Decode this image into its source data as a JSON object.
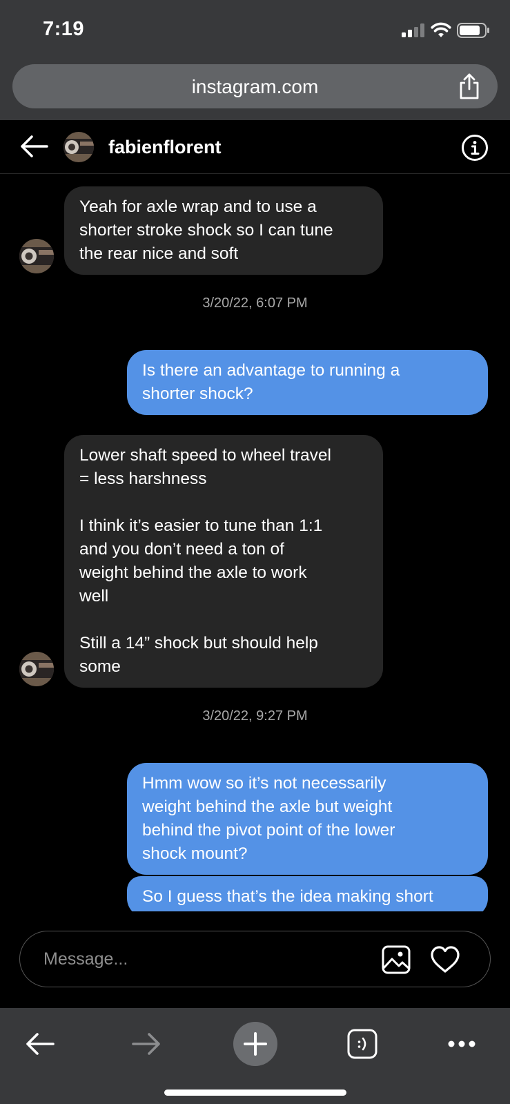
{
  "status_bar": {
    "time": "7:19"
  },
  "browser": {
    "url": "instagram.com"
  },
  "header": {
    "username": "fabienflorent"
  },
  "messages": [
    {
      "type": "incoming",
      "text": "Yeah for axle wrap and to use a\nshorter stroke shock so I can tune\nthe rear nice and soft"
    },
    {
      "type": "timestamp",
      "text": "3/20/22, 6:07 PM"
    },
    {
      "type": "outgoing",
      "text": "Is there an advantage to running a\nshorter shock?"
    },
    {
      "type": "incoming",
      "text": "Lower shaft speed to wheel travel\n= less harshness\n\nI think it’s easier to tune than 1:1\nand you don’t need a ton of\nweight behind the axle to work\nwell\n\nStill a 14” shock but should help\nsome"
    },
    {
      "type": "timestamp",
      "text": "3/20/22, 9:27 PM"
    },
    {
      "type": "outgoing",
      "text": "Hmm wow so it’s not necessarily\nweight behind the axle but weight\nbehind the pivot point of the lower\nshock mount?"
    },
    {
      "type": "outgoing",
      "text": "So I guess that’s the idea making short"
    }
  ],
  "composer": {
    "placeholder": "Message..."
  },
  "icons": {
    "back": "arrow-left-icon",
    "info": "info-icon",
    "share": "share-icon",
    "gallery": "image-icon",
    "heart": "heart-icon",
    "forward": "arrow-right-icon",
    "new_tab": "plus-icon",
    "tabs": "tabs-icon",
    "more": "more-icon"
  },
  "colors": {
    "outgoing_bubble": "#5492e6",
    "incoming_bubble": "#262626",
    "chrome": "#38393b",
    "background": "#000000"
  }
}
